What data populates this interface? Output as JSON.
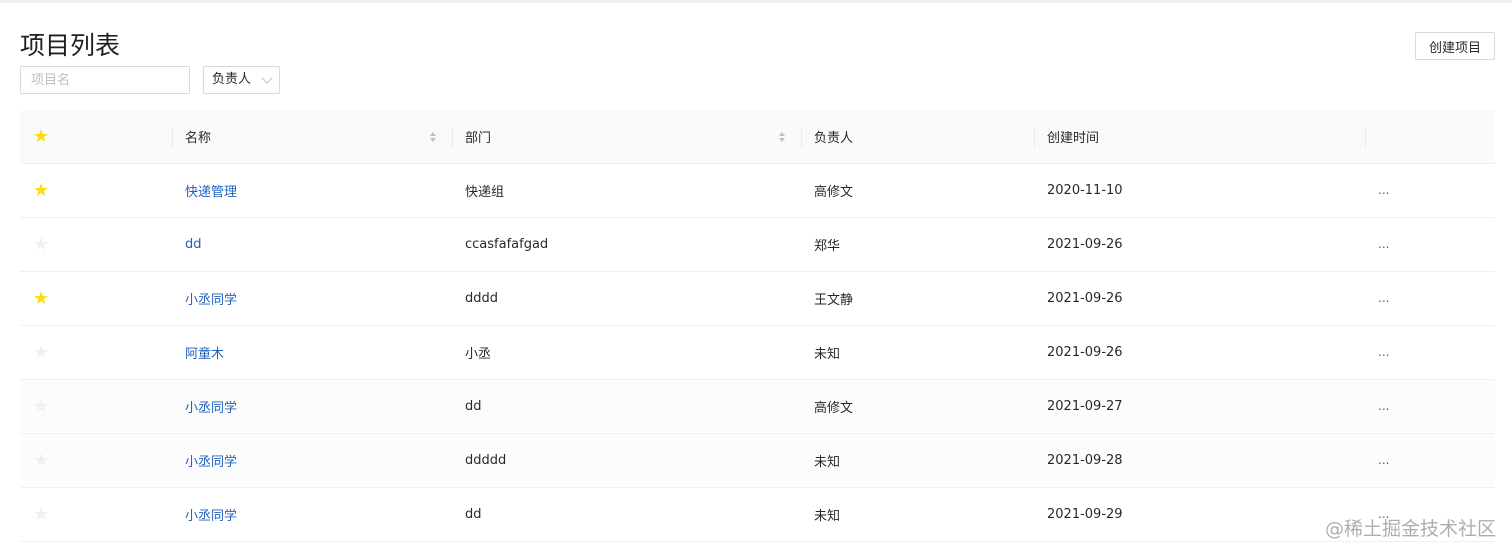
{
  "header": {
    "title": "项目列表",
    "create_label": "创建项目"
  },
  "filters": {
    "name_placeholder": "项目名",
    "owner_label": "负责人"
  },
  "table": {
    "columns": {
      "name": "名称",
      "department": "部门",
      "owner": "负责人",
      "created": "创建时间"
    },
    "rows": [
      {
        "pinned": true,
        "name": "快递管理",
        "department": "快递组",
        "owner": "高修文",
        "created": "2020-11-10",
        "more": "..."
      },
      {
        "pinned": false,
        "name": "dd",
        "department": "ccasfafafgad",
        "owner": "郑华",
        "created": "2021-09-26",
        "more": "..."
      },
      {
        "pinned": true,
        "name": "小丞同学",
        "department": "dddd",
        "owner": "王文静",
        "created": "2021-09-26",
        "more": "..."
      },
      {
        "pinned": false,
        "name": "阿童木",
        "department": "小丞",
        "owner": "未知",
        "created": "2021-09-26",
        "more": "..."
      },
      {
        "pinned": false,
        "name": "小丞同学",
        "department": "dd",
        "owner": "高修文",
        "created": "2021-09-27",
        "more": "..."
      },
      {
        "pinned": false,
        "name": "小丞同学",
        "department": "ddddd",
        "owner": "未知",
        "created": "2021-09-28",
        "more": "..."
      },
      {
        "pinned": false,
        "name": "小丞同学",
        "department": "dd",
        "owner": "未知",
        "created": "2021-09-29",
        "more": "..."
      }
    ]
  },
  "watermark": "@稀土掘金技术社区",
  "colors": {
    "star_on": "#fadb14",
    "star_off": "#f0f0f0",
    "link": "#1f5fbf"
  },
  "icons": {
    "star": "★"
  }
}
